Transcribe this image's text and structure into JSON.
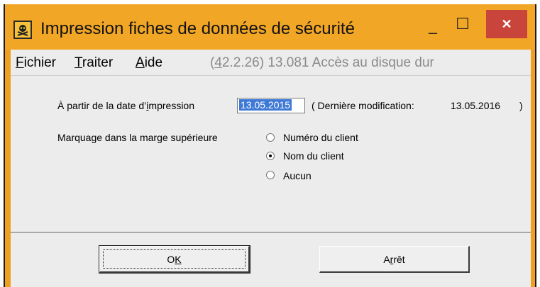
{
  "window": {
    "title": "Impression fiches de données de sécurité",
    "controls": {
      "minimize": "–",
      "maximize": "☐",
      "close": "✕"
    },
    "icon": "hazard-skull-icon",
    "accent_color": "#f2a625",
    "close_color": "#c9453b"
  },
  "menu": {
    "file": {
      "hotkey": "F",
      "rest": "ichier"
    },
    "process": {
      "hotkey": "T",
      "rest": "raiter"
    },
    "help": {
      "hotkey": "A",
      "rest": "ide"
    },
    "info_prefix": "(",
    "info_hotkey": "4",
    "info_rest": "2.2.26) 13.081 Accès au disque dur"
  },
  "form": {
    "date_label_pre": "À partir de la date d’",
    "date_label_hotkey": "i",
    "date_label_post": "mpression",
    "date_value": "13.05.2015",
    "last_mod_label": "( Dernière modification:",
    "last_mod_value": "13.05.2016",
    "last_mod_close": ")",
    "marking_label": "Marquage dans la marge supérieure",
    "options": [
      {
        "label": "Numéro du client",
        "checked": false
      },
      {
        "label": "Nom du client",
        "checked": true
      },
      {
        "label": "Aucun",
        "checked": false
      }
    ]
  },
  "buttons": {
    "ok_pre": "O",
    "ok_hotkey": "K",
    "stop_pre": "A",
    "stop_hotkey": "r",
    "stop_post": "rêt"
  }
}
